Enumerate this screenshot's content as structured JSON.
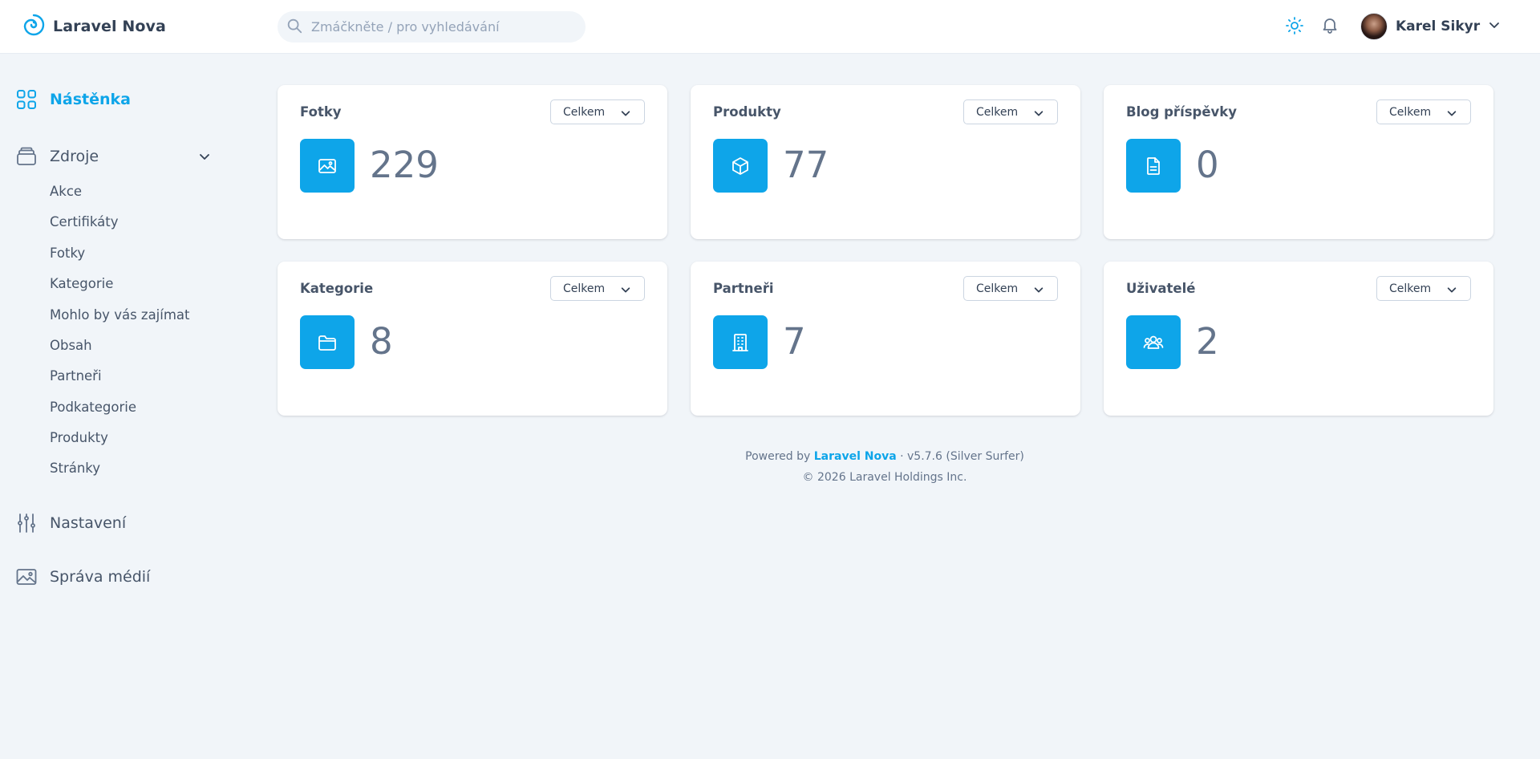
{
  "header": {
    "brand": "Laravel Nova",
    "search_placeholder": "Zmáčkněte / pro vyhledávání",
    "user_name": "Karel Sikyr"
  },
  "sidebar": {
    "dashboard": "Nástěnka",
    "resources": "Zdroje",
    "resource_items": [
      "Akce",
      "Certifikáty",
      "Fotky",
      "Kategorie",
      "Mohlo by vás zajímat",
      "Obsah",
      "Partneři",
      "Podkategorie",
      "Produkty",
      "Stránky"
    ],
    "settings": "Nastavení",
    "media": "Správa médií"
  },
  "cards": [
    {
      "title": "Fotky",
      "range": "Celkem",
      "value": "229",
      "icon": "image-icon"
    },
    {
      "title": "Produkty",
      "range": "Celkem",
      "value": "77",
      "icon": "cube-icon"
    },
    {
      "title": "Blog příspěvky",
      "range": "Celkem",
      "value": "0",
      "icon": "document-icon"
    },
    {
      "title": "Kategorie",
      "range": "Celkem",
      "value": "8",
      "icon": "folder-icon"
    },
    {
      "title": "Partneři",
      "range": "Celkem",
      "value": "7",
      "icon": "office-building-icon"
    },
    {
      "title": "Uživatelé",
      "range": "Celkem",
      "value": "2",
      "icon": "users-icon"
    }
  ],
  "footer": {
    "powered_prefix": "Powered by",
    "link": "Laravel Nova",
    "version": "· v5.7.6 (Silver Surfer)",
    "copyright": "© 2026 Laravel Holdings Inc."
  },
  "colors": {
    "accent": "#0ea5e9",
    "background": "#f1f5f9",
    "text": "#475569",
    "value": "#64748b"
  }
}
